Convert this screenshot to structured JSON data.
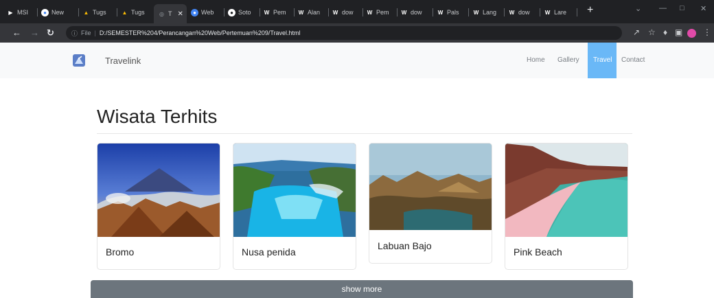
{
  "browser": {
    "tabs": [
      {
        "label": "MSI",
        "icon": "media-icon"
      },
      {
        "label": "New",
        "icon": "chrome-icon"
      },
      {
        "label": "Tugs",
        "icon": "drive-icon"
      },
      {
        "label": "Tugs",
        "icon": "drive-icon"
      },
      {
        "label": "T",
        "icon": "globe-icon"
      },
      {
        "label": "Web",
        "icon": "chrome-icon"
      },
      {
        "label": "Soto",
        "icon": "chrome-icon"
      },
      {
        "label": "Pem",
        "icon": "word-icon"
      },
      {
        "label": "Alan",
        "icon": "word-icon"
      },
      {
        "label": "dow",
        "icon": "word-icon"
      },
      {
        "label": "Pem",
        "icon": "word-icon"
      },
      {
        "label": "dow",
        "icon": "word-icon"
      },
      {
        "label": "Pals",
        "icon": "word-icon"
      },
      {
        "label": "Lang",
        "icon": "word-icon"
      },
      {
        "label": "dow",
        "icon": "word-icon"
      },
      {
        "label": "Lare",
        "icon": "word-icon"
      }
    ],
    "address": {
      "scheme": "File",
      "url": "D:/SEMESTER%204/Perancangan%20Web/Pertemuan%209/Travel.html"
    }
  },
  "navbar": {
    "brand": "Travelink",
    "links": [
      "Home",
      "Gallery",
      "Travel",
      "Contact"
    ],
    "active": "Travel"
  },
  "main": {
    "heading": "Wisata Terhits",
    "cards": [
      {
        "title": "Bromo"
      },
      {
        "title": "Nusa penida"
      },
      {
        "title": "Labuan Bajo"
      },
      {
        "title": "Pink Beach"
      }
    ],
    "button": "show more"
  },
  "colors": {
    "active_nav": "#6ab8f7",
    "button": "#6c757d",
    "chrome_dark": "#202124"
  }
}
